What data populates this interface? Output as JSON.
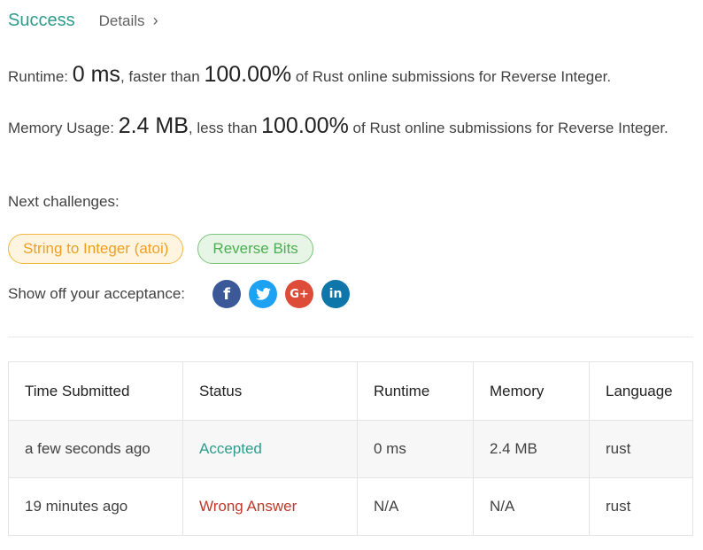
{
  "header": {
    "status": "Success",
    "details_label": "Details",
    "chevron": "›"
  },
  "runtime": {
    "label": "Runtime: ",
    "value": "0 ms",
    "mid": ", faster than ",
    "percent": "100.00%",
    "suffix": " of Rust online submissions for Reverse Integer."
  },
  "memory": {
    "label": "Memory Usage: ",
    "value": "2.4 MB",
    "mid": ", less than ",
    "percent": "100.00%",
    "suffix": " of Rust online submissions for Reverse Integer."
  },
  "next_challenges": {
    "label": "Next challenges:",
    "items": [
      {
        "label": "String to Integer (atoi)",
        "difficulty": "medium",
        "color": "#f0a020"
      },
      {
        "label": "Reverse Bits",
        "difficulty": "easy",
        "color": "#4caf50"
      }
    ]
  },
  "share": {
    "label": "Show off your acceptance:",
    "icons": [
      {
        "name": "facebook-icon",
        "glyph": "f",
        "color": "#3b5998"
      },
      {
        "name": "twitter-icon",
        "glyph": "",
        "color": "#1da1f2"
      },
      {
        "name": "google-plus-icon",
        "glyph": "G+",
        "color": "#dd4b39"
      },
      {
        "name": "linkedin-icon",
        "glyph": "in",
        "color": "#0e76a8"
      }
    ]
  },
  "table": {
    "headers": [
      "Time Submitted",
      "Status",
      "Runtime",
      "Memory",
      "Language"
    ],
    "rows": [
      {
        "time": "a few seconds ago",
        "status": "Accepted",
        "status_type": "accepted",
        "runtime": "0 ms",
        "memory": "2.4 MB",
        "language": "rust"
      },
      {
        "time": "19 minutes ago",
        "status": "Wrong Answer",
        "status_type": "wrong",
        "runtime": "N/A",
        "memory": "N/A",
        "language": "rust"
      }
    ]
  },
  "colors": {
    "success": "#2e9c8c",
    "wrong": "#c0392b"
  }
}
